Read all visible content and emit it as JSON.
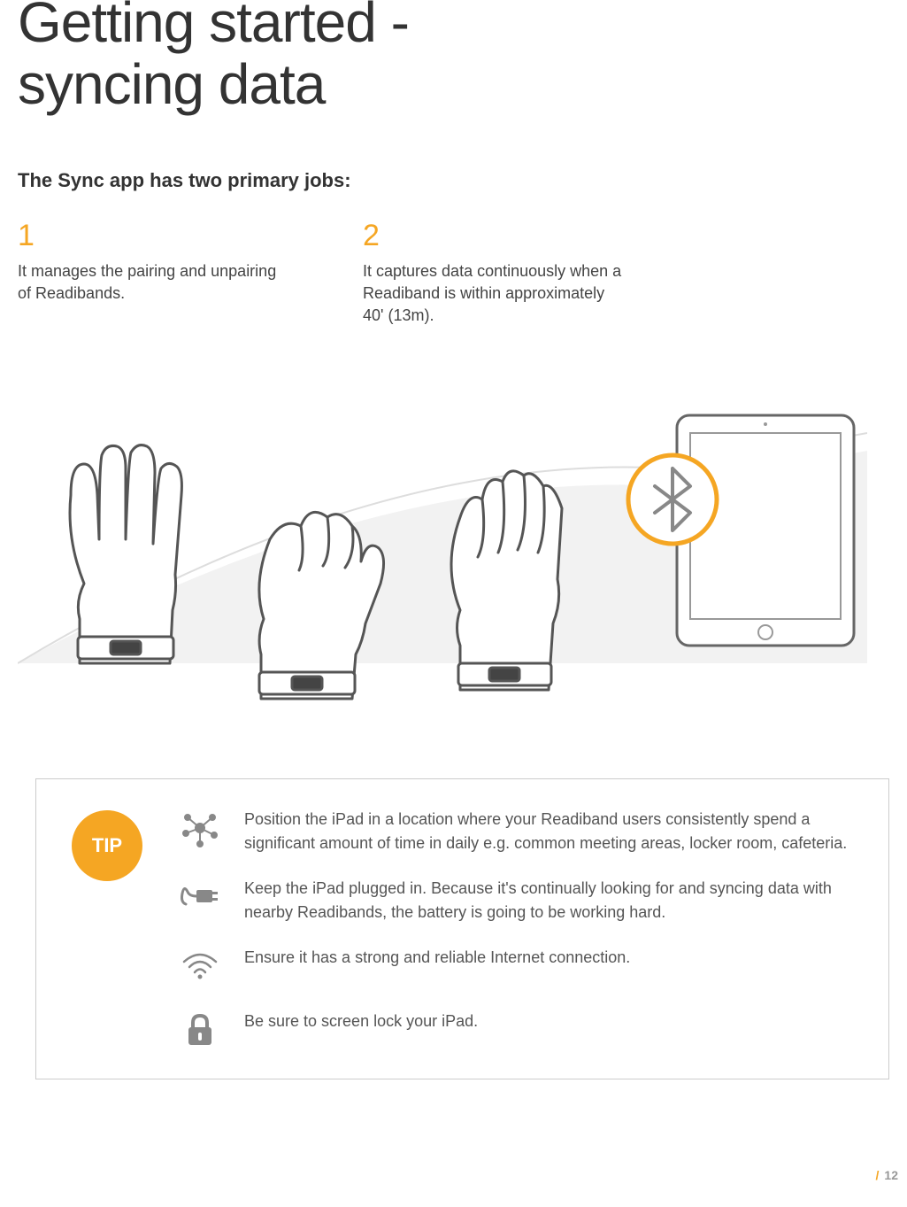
{
  "title_line1": "Getting started -",
  "title_line2": "syncing data",
  "subhead": "The Sync app has two primary jobs:",
  "jobs": [
    {
      "num": "1",
      "text": "It manages the pairing and unpairing of Readibands."
    },
    {
      "num": "2",
      "text": "It captures data continuously when a Readiband is within approximately 40' (13m)."
    }
  ],
  "tip_label": "TIP",
  "tips": [
    {
      "icon": "network",
      "text": "Position the iPad in a location where your Readiband users consistently spend a significant amount of time in daily e.g. common meeting areas, locker room, cafeteria."
    },
    {
      "icon": "plug",
      "text": "Keep the iPad plugged in. Because it's continually looking for and syncing data with nearby Readibands, the battery is going to be working hard."
    },
    {
      "icon": "wifi",
      "text": "Ensure it has a strong and reliable Internet connection."
    },
    {
      "icon": "lock",
      "text": "Be sure to screen lock your iPad."
    }
  ],
  "page_number": "12"
}
